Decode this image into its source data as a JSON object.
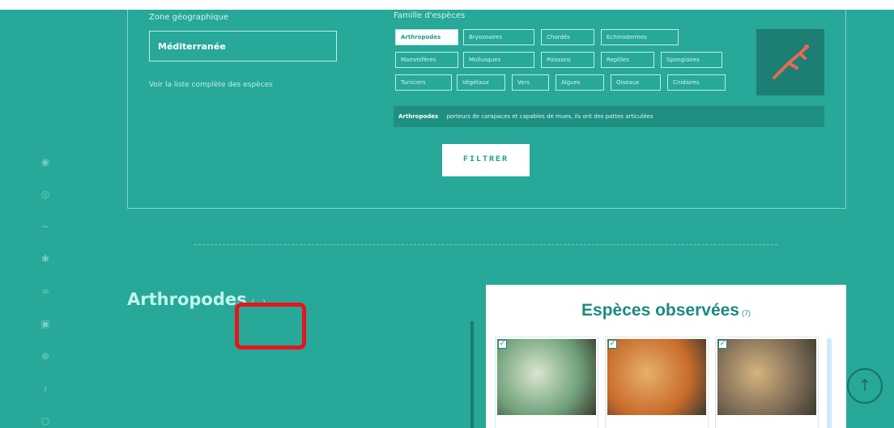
{
  "filter": {
    "zone_label": "Zone géographique",
    "zone_value": "Méditerranée",
    "species_link": "Voir la liste complète des espèces",
    "family_label": "Famille d'espèces",
    "chips": [
      {
        "label": "Arthropodes",
        "active": true
      },
      {
        "label": "Bryozoaires",
        "active": false
      },
      {
        "label": "Chordés",
        "active": false
      },
      {
        "label": "Echinodermes",
        "active": false
      },
      {
        "label": "Mammifères",
        "active": false
      },
      {
        "label": "Mollusques",
        "active": false
      },
      {
        "label": "Poissons",
        "active": false
      },
      {
        "label": "Reptiles",
        "active": false
      },
      {
        "label": "Spongiaires",
        "active": false
      },
      {
        "label": "Tuniciers",
        "active": false
      },
      {
        "label": "Végétaux",
        "active": false
      },
      {
        "label": "Vers",
        "active": false
      },
      {
        "label": "Algues",
        "active": false
      },
      {
        "label": "Oiseaux",
        "active": false
      },
      {
        "label": "Cnidaires",
        "active": false
      }
    ],
    "desc_title": "Arthropodes",
    "desc_text": "porteurs de carapaces et capables de mues, ils ont des pattes articulées",
    "button_label": "FILTRER"
  },
  "section": {
    "title": "Arthropodes",
    "count": "(...)"
  },
  "observed": {
    "title": "Espèces observées",
    "count": "(7)",
    "cards": [
      {
        "color_a": "#6fa07a",
        "color_b": "#d9e6cf"
      },
      {
        "color_a": "#c86a2a",
        "color_b": "#e7b06d"
      },
      {
        "color_a": "#7b6a55",
        "color_b": "#d5b37e"
      }
    ]
  },
  "rail_icons": [
    "home-icon",
    "target-icon",
    "wave-icon",
    "star-icon",
    "fish-icon",
    "grid-icon",
    "globe-icon",
    "person-icon",
    "info-icon"
  ],
  "scroll_top_symbol": "↑",
  "colors": {
    "accent": "#27a898",
    "panel_dark": "#1f8f82"
  }
}
